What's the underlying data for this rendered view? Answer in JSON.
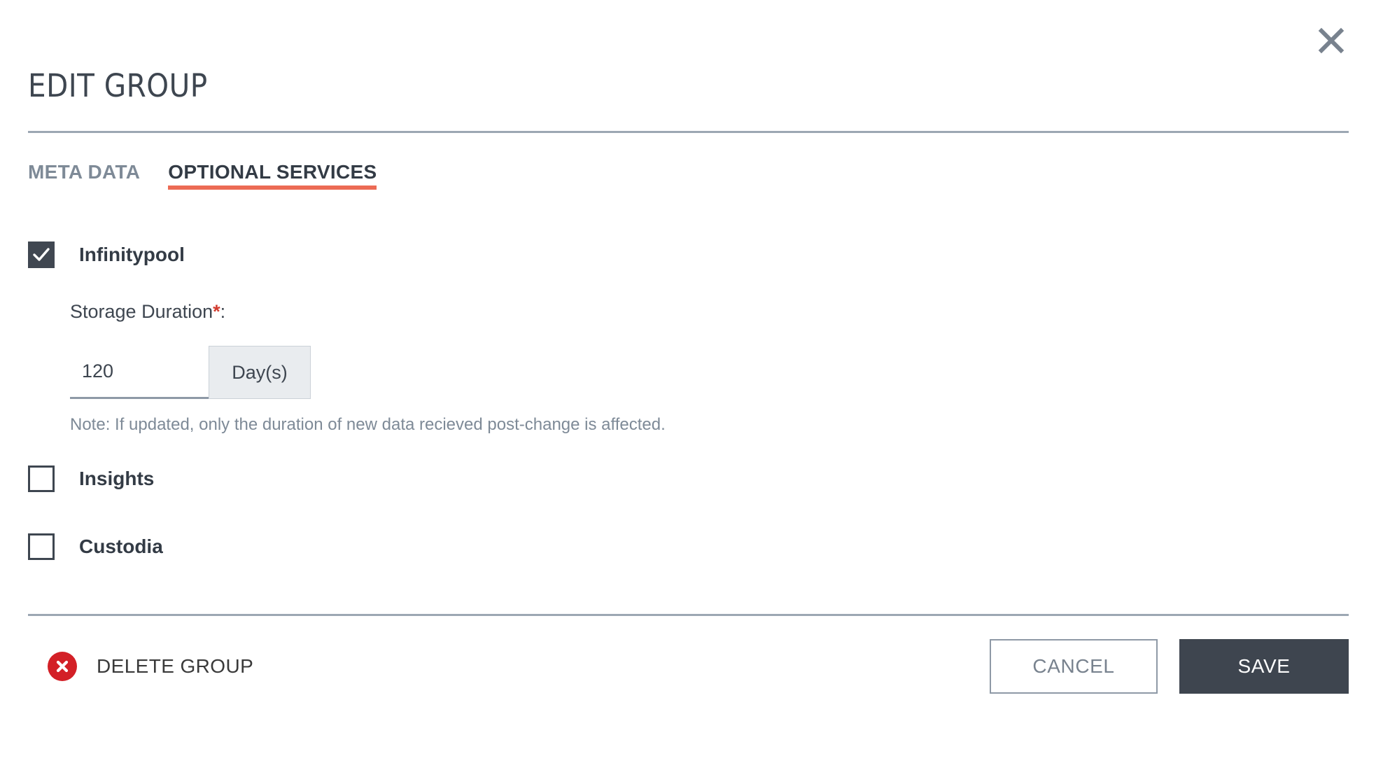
{
  "dialog": {
    "title": "EDIT GROUP",
    "close_icon": "close-icon"
  },
  "tabs": [
    {
      "label": "META DATA",
      "active": false
    },
    {
      "label": "OPTIONAL SERVICES",
      "active": true
    }
  ],
  "services": [
    {
      "label": "Infinitypool",
      "checked": true
    },
    {
      "label": "Insights",
      "checked": false
    },
    {
      "label": "Custodia",
      "checked": false
    }
  ],
  "storage_duration": {
    "label": "Storage Duration",
    "required_marker": "*",
    "label_suffix": ":",
    "value": "120",
    "placeholder": "120",
    "unit": "Day(s)",
    "note": "Note: If updated, only the duration of new data recieved post-change is affected."
  },
  "footer": {
    "delete_label": "DELETE GROUP",
    "delete_icon": "circle-x-icon",
    "cancel_label": "CANCEL",
    "save_label": "SAVE"
  },
  "colors": {
    "accent": "#EC6B55",
    "dark": "#3E454F",
    "danger": "#D32027",
    "muted": "#7E8A97",
    "divider": "#9CA7B3"
  }
}
